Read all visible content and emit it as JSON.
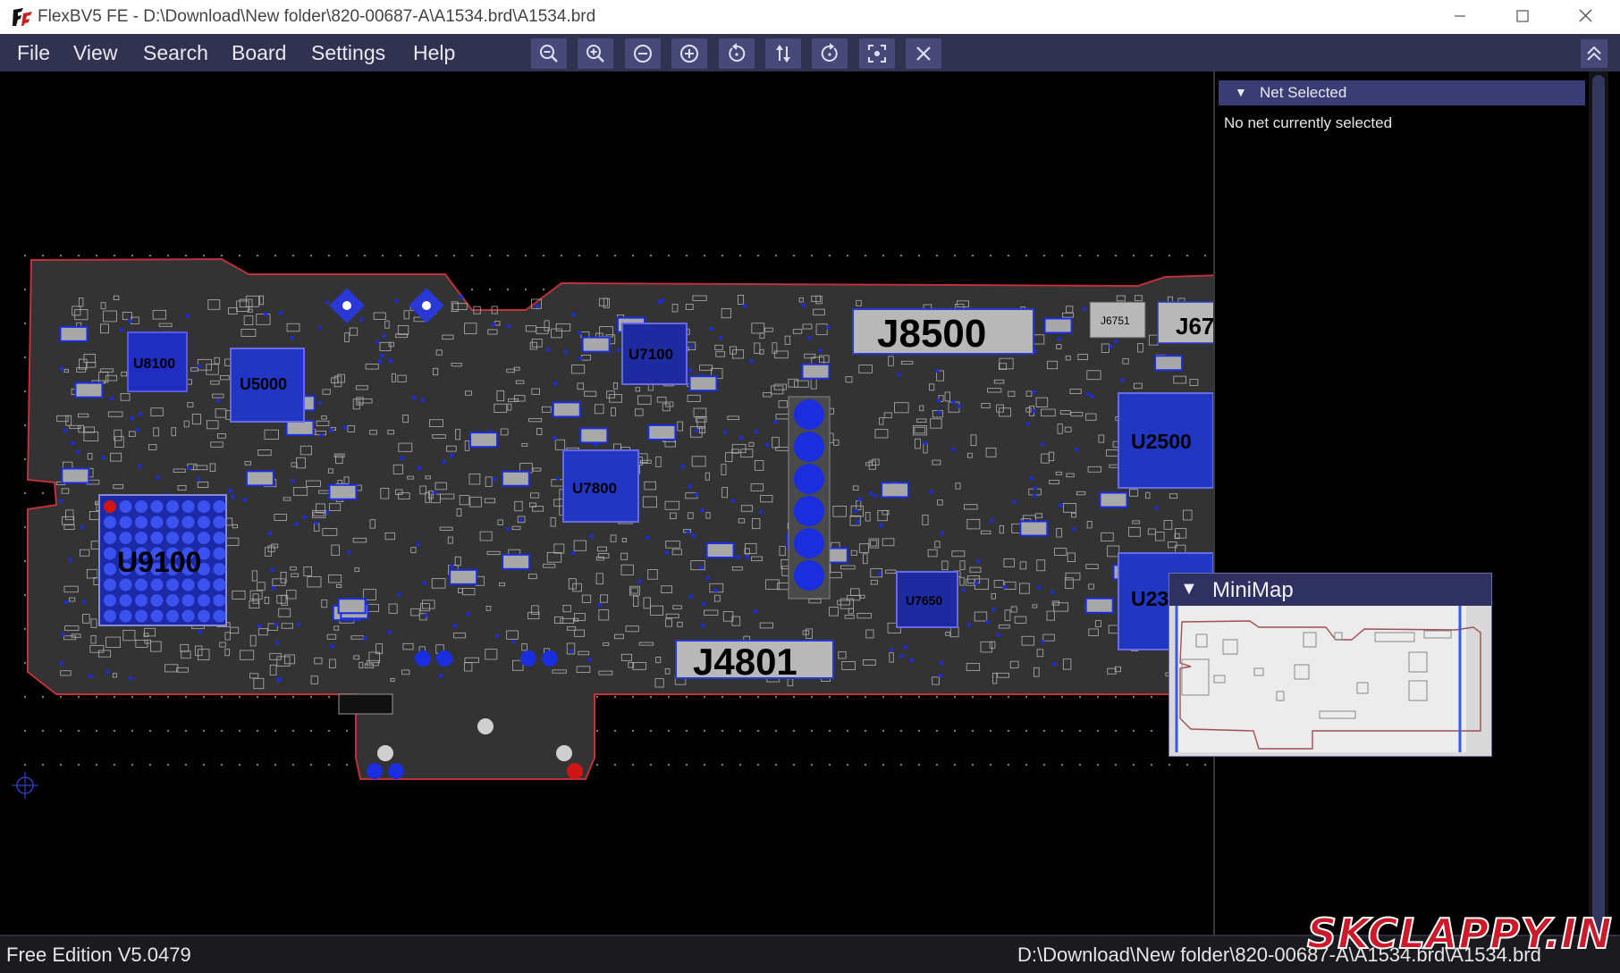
{
  "window": {
    "title": "FlexBV5 FE - D:\\Download\\New folder\\820-00687-A\\A1534.brd\\A1534.brd"
  },
  "menu": {
    "items": [
      "File",
      "View",
      "Search",
      "Board",
      "Settings",
      "Help"
    ]
  },
  "toolbar": {
    "icons": [
      "zoom-out-icon",
      "zoom-in-icon",
      "zoom-minus-icon",
      "zoom-plus-icon",
      "rotate-left-icon",
      "flip-icon",
      "rotate-right-icon",
      "zoom-fit-icon",
      "close-icon"
    ]
  },
  "board": {
    "labels": {
      "j8500": "J8500",
      "j4801": "J4801",
      "u9100": "U9100",
      "u7100": "U7100",
      "u2500": "U2500",
      "u5000": "U5000",
      "u7800": "U7800",
      "u8100": "U8100",
      "u7650": "U7650",
      "j6751": "J6751",
      "j67": "J67",
      "u23": "U23"
    },
    "colors": {
      "board_fill": "#333333",
      "outline": "#c0313a",
      "pad_blue": "#1a2ee0",
      "pad_red": "#d01515",
      "component": "#b0b0b0",
      "grid_dot": "#7a7a7a"
    }
  },
  "net_panel": {
    "header": "Net Selected",
    "status": "No net currently selected"
  },
  "minimap": {
    "title": "MiniMap"
  },
  "statusbar": {
    "edition": "Free Edition  V5.0479",
    "path": "D:\\Download\\New folder\\820-00687-A\\A1534.brd\\A1534.brd"
  },
  "watermark": {
    "text": "SKCLAPPY.IN"
  }
}
